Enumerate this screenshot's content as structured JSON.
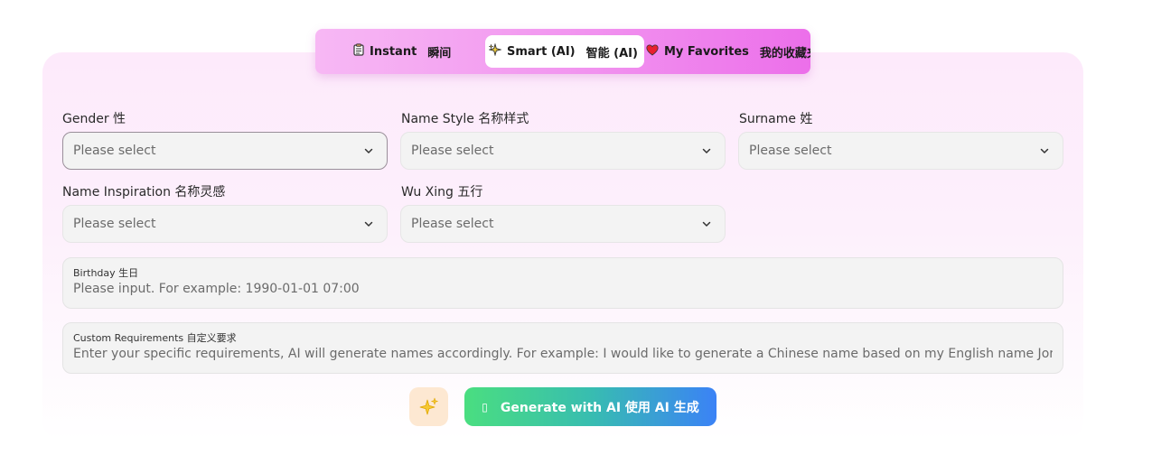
{
  "tabs": {
    "instant": {
      "label": "Instant",
      "label_cn": "瞬间",
      "icon": "clipboard-icon"
    },
    "smart": {
      "label": "Smart (AI)",
      "label_cn": "智能 (AI)",
      "icon": "sparkle-icon"
    },
    "favorites": {
      "label": "My Favorites",
      "label_cn": "我的收藏夹",
      "icon": "heart-icon"
    },
    "active": "smart"
  },
  "form": {
    "gender": {
      "label": "Gender 性",
      "placeholder": "Please select"
    },
    "name_style": {
      "label": "Name Style 名称样式",
      "placeholder": "Please select"
    },
    "surname": {
      "label": "Surname 姓",
      "placeholder": "Please select"
    },
    "name_inspiration": {
      "label": "Name Inspiration 名称灵感",
      "placeholder": "Please select"
    },
    "wu_xing": {
      "label": "Wu Xing 五行",
      "placeholder": "Please select"
    },
    "birthday": {
      "label": "Birthday 生日",
      "placeholder": "Please input. For example: 1990-01-01 07:00"
    },
    "custom": {
      "label": "Custom Requirements 自定义要求",
      "placeholder": "Enter your specific requirements, AI will generate names accordingly. For example: I would like to generate a Chinese name based on my English name Jonny."
    }
  },
  "actions": {
    "generate_label": "Generate with AI 使用 AI 生成",
    "generate_icon_glyph": "▯",
    "sparkle_icon": "sparkles-icon"
  },
  "colors": {
    "tab_gradient_start": "#f7b8f4",
    "tab_gradient_end": "#ec6fea",
    "generate_gradient_start": "#4ade80",
    "generate_gradient_end": "#3b82f6",
    "sparkle_bg": "#fde8d2"
  }
}
